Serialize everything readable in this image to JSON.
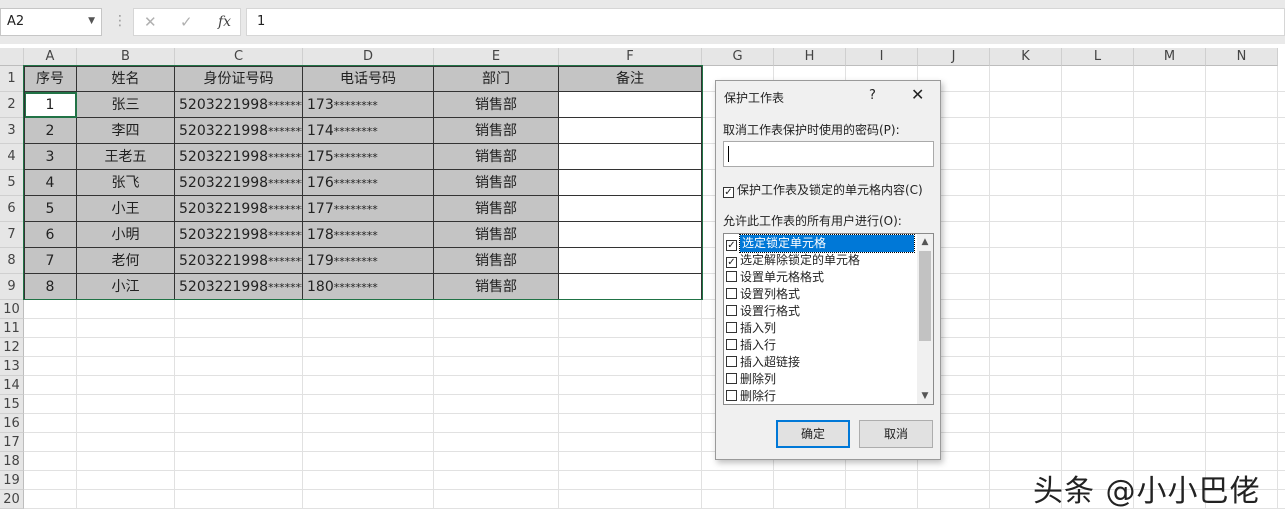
{
  "formula_bar": {
    "name_box": "A2",
    "cancel_icon": "✕",
    "enter_icon": "✓",
    "fx_icon": "fx",
    "value": "1"
  },
  "columns": [
    "A",
    "B",
    "C",
    "D",
    "E",
    "F",
    "G",
    "H",
    "I",
    "J",
    "K",
    "L",
    "M",
    "N"
  ],
  "rows": [
    "1",
    "2",
    "3",
    "4",
    "5",
    "6",
    "7",
    "8",
    "9",
    "10",
    "11",
    "12",
    "13",
    "14",
    "15",
    "16",
    "17",
    "18",
    "19",
    "20"
  ],
  "table": {
    "headers": [
      "序号",
      "姓名",
      "身份证号码",
      "电话号码",
      "部门",
      "备注"
    ],
    "rows": [
      {
        "no": "1",
        "name": "张三",
        "id": "5203221998",
        "id_mask": "*******",
        "phone": "173",
        "phone_mask": "********",
        "dept": "销售部",
        "note": ""
      },
      {
        "no": "2",
        "name": "李四",
        "id": "5203221998",
        "id_mask": "*******",
        "phone": "174",
        "phone_mask": "********",
        "dept": "销售部",
        "note": ""
      },
      {
        "no": "3",
        "name": "王老五",
        "id": "5203221998",
        "id_mask": "*******",
        "phone": "175",
        "phone_mask": "********",
        "dept": "销售部",
        "note": ""
      },
      {
        "no": "4",
        "name": "张飞",
        "id": "5203221998",
        "id_mask": "*******",
        "phone": "176",
        "phone_mask": "********",
        "dept": "销售部",
        "note": ""
      },
      {
        "no": "5",
        "name": "小王",
        "id": "5203221998",
        "id_mask": "*******",
        "phone": "177",
        "phone_mask": "********",
        "dept": "销售部",
        "note": ""
      },
      {
        "no": "6",
        "name": "小明",
        "id": "5203221998",
        "id_mask": "*******",
        "phone": "178",
        "phone_mask": "********",
        "dept": "销售部",
        "note": ""
      },
      {
        "no": "7",
        "name": "老何",
        "id": "5203221998",
        "id_mask": "*******",
        "phone": "179",
        "phone_mask": "********",
        "dept": "销售部",
        "note": ""
      },
      {
        "no": "8",
        "name": "小江",
        "id": "5203221998",
        "id_mask": "*******",
        "phone": "180",
        "phone_mask": "********",
        "dept": "销售部",
        "note": ""
      }
    ]
  },
  "dialog": {
    "title": "保护工作表",
    "help": "?",
    "close": "✕",
    "password_label": "取消工作表保护时使用的密码(P):",
    "password_value": "",
    "protect_checkbox_label": "保护工作表及锁定的单元格内容(C)",
    "protect_checked": true,
    "allow_label": "允许此工作表的所有用户进行(O):",
    "permissions": [
      {
        "label": "选定锁定单元格",
        "checked": true,
        "selected": true
      },
      {
        "label": "选定解除锁定的单元格",
        "checked": true,
        "selected": false
      },
      {
        "label": "设置单元格格式",
        "checked": false,
        "selected": false
      },
      {
        "label": "设置列格式",
        "checked": false,
        "selected": false
      },
      {
        "label": "设置行格式",
        "checked": false,
        "selected": false
      },
      {
        "label": "插入列",
        "checked": false,
        "selected": false
      },
      {
        "label": "插入行",
        "checked": false,
        "selected": false
      },
      {
        "label": "插入超链接",
        "checked": false,
        "selected": false
      },
      {
        "label": "删除列",
        "checked": false,
        "selected": false
      },
      {
        "label": "删除行",
        "checked": false,
        "selected": false
      }
    ],
    "ok_label": "确定",
    "cancel_label": "取消"
  },
  "watermark": "头条 @小小巴佬"
}
